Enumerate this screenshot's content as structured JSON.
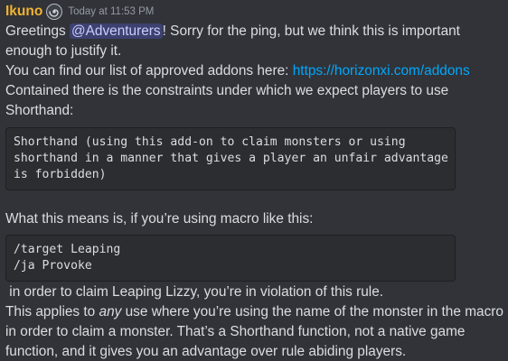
{
  "message": {
    "author": "Ikuno",
    "timestamp": "Today at 11:53 PM",
    "role_icon": "spiral-role-icon",
    "colors": {
      "author": "#f0b232",
      "link": "#00a8fc",
      "mention_bg": "#5865f24d",
      "background": "#313338",
      "code_bg": "#2b2d31"
    },
    "p1": {
      "prefix": "Greetings ",
      "mention": "@Adventurers",
      "suffix": "! Sorry for the ping, but we think this is important",
      "line2": "enough to justify it."
    },
    "p2": {
      "text": "You can find our list of approved addons here: ",
      "link": "https://horizonxi.com/addons"
    },
    "p3": {
      "line1": "Contained there is the constraints under which we expect players to use",
      "line2": "Shorthand:"
    },
    "code1": {
      "line1": "Shorthand (using this add-on to claim monsters or using",
      "line2": "shorthand in a manner that gives a player an unfair advantage",
      "line3": "is forbidden)"
    },
    "p4": {
      "text": "What this means is, if you’re using macro like this:"
    },
    "code2": {
      "line1": "/target Leaping",
      "line2": "/ja Provoke"
    },
    "p5": {
      "text": " in order to claim Leaping Lizzy, you’re in violation of this rule."
    },
    "p6": {
      "line1_prefix": "This applies to ",
      "line1_em": "any",
      "line1_suffix": " use where you’re using the name of the monster in the macro",
      "line2": "in order to claim a monster. That’s a Shorthand function, not a native game",
      "line3": "function, and it gives you an advantage over rule abiding players."
    }
  }
}
